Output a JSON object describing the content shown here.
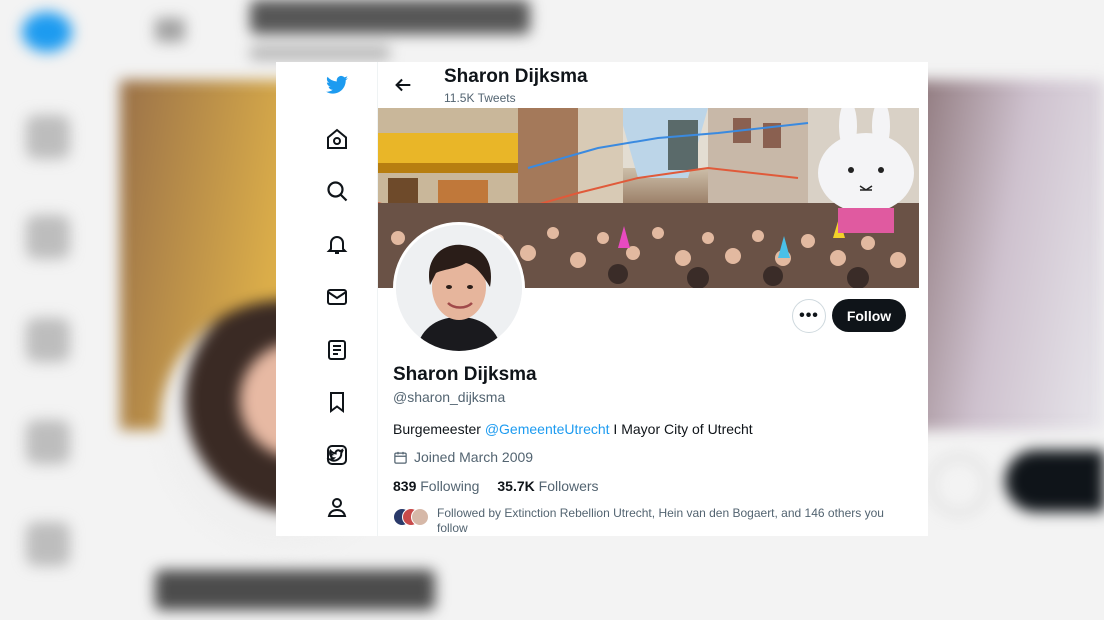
{
  "app": {
    "name": "Twitter"
  },
  "header": {
    "name": "Sharon Dijksma",
    "tweet_count": "11.5K Tweets"
  },
  "profile": {
    "name": "Sharon Dijksma",
    "handle": "@sharon_dijksma",
    "bio_prefix": "Burgemeester ",
    "bio_mention": "@GemeenteUtrecht",
    "bio_suffix": " I Mayor City of Utrecht",
    "joined": "Joined March 2009",
    "following_count": "839",
    "following_label": "Following",
    "followers_count": "35.7K",
    "followers_label": "Followers",
    "followed_by": "Followed by Extinction Rebellion Utrecht, Hein van den Bogaert, and 146 others you follow"
  },
  "actions": {
    "more_label": "•••",
    "follow_label": "Follow"
  },
  "sidebar": {
    "items": [
      {
        "icon": "twitter-bird-icon"
      },
      {
        "icon": "home-icon"
      },
      {
        "icon": "search-icon"
      },
      {
        "icon": "bell-icon"
      },
      {
        "icon": "mail-icon"
      },
      {
        "icon": "lists-icon"
      },
      {
        "icon": "bookmark-icon"
      },
      {
        "icon": "twitter-blue-icon"
      },
      {
        "icon": "profile-icon"
      }
    ]
  },
  "colors": {
    "accent": "#1d9bf0",
    "text": "#0f1419",
    "secondary": "#536471",
    "follow_bg": "#0f1419"
  }
}
